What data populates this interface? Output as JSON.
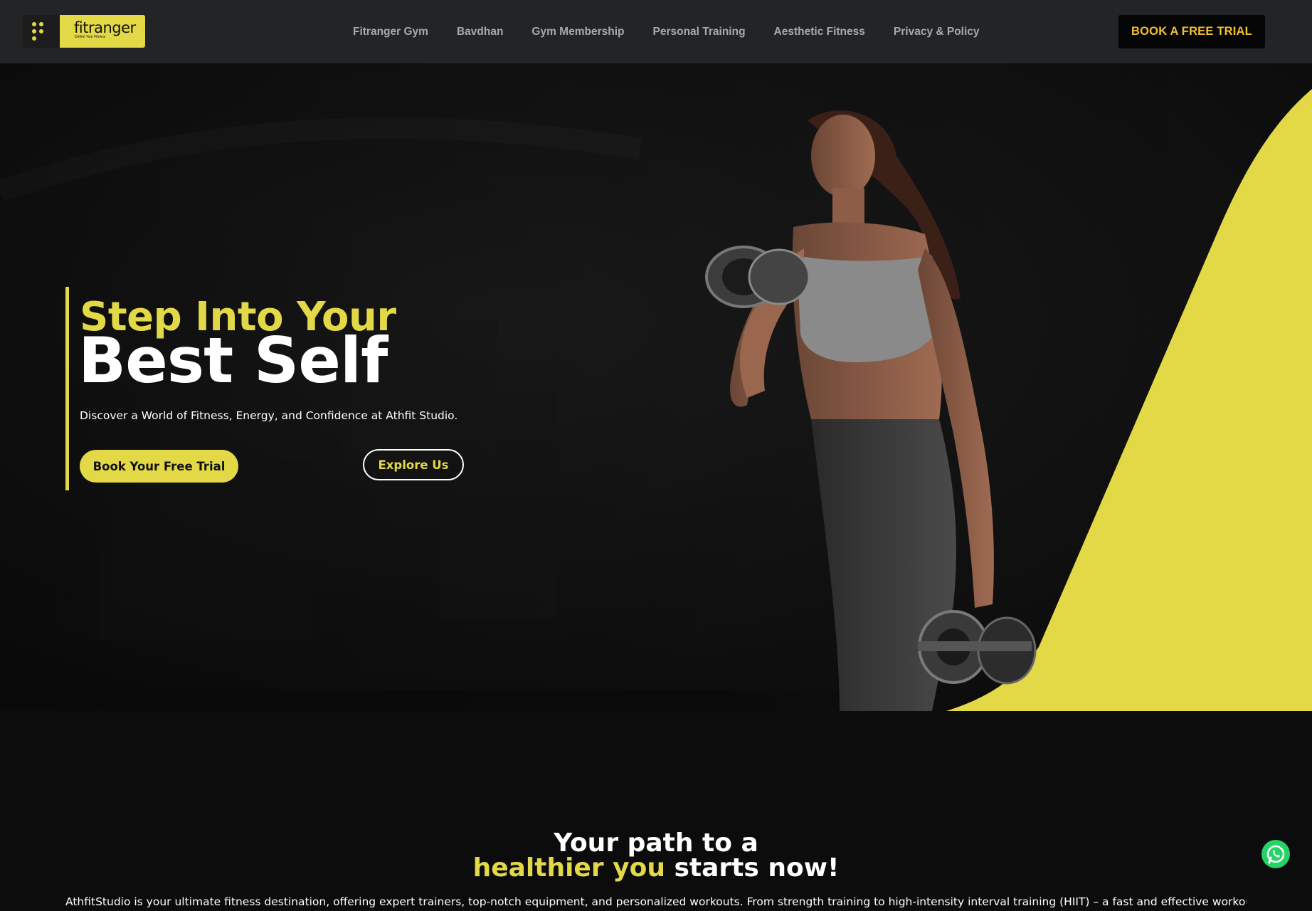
{
  "header": {
    "logo": {
      "name": "fitranger",
      "tagline": "Define Your Fitness"
    },
    "nav": [
      "Fitranger Gym",
      "Bavdhan",
      "Gym Membership",
      "Personal Training",
      "Aesthetic Fitness",
      "Privacy & Policy"
    ],
    "cta_label": "BOOK A FREE TRIAL"
  },
  "hero": {
    "headline_line1": "Step Into Your",
    "headline_line2": "Best Self",
    "subtitle": "Discover a World of Fitness, Energy, and Confidence at Athfit Studio.",
    "primary_button": "Book Your Free Trial",
    "secondary_button": "Explore Us"
  },
  "intro": {
    "title_line1": "Your path to a",
    "title_highlight": "healthier you",
    "title_rest": " starts now!",
    "body": "AthfitStudio is your ultimate fitness destination, offering expert trainers, top-notch equipment, and personalized workouts. From strength training to high-intensity interval training (HIIT) – a fast and effective workout"
  },
  "icons": {
    "whatsapp": "whatsapp-icon",
    "logo_mark": "dots-grid-icon"
  },
  "colors": {
    "accent": "#e3d947",
    "header_bg": "#222426",
    "cta_text": "#f2c12e",
    "page_bg": "#0c0c0c"
  }
}
